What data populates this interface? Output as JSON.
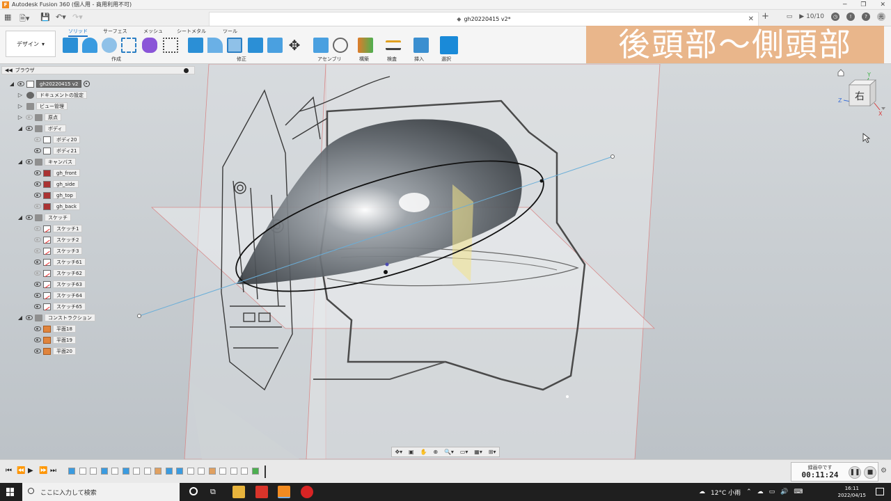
{
  "window": {
    "app_title": "Autodesk Fusion 360 (個人用 - 商用利用不可)",
    "app_icon": "fusion-logo-icon",
    "controls": [
      "minimize-icon",
      "restore-icon",
      "close-icon"
    ]
  },
  "document": {
    "tab_title": "gh20220415 v2*",
    "job_status": "10/10"
  },
  "user": {
    "initials": "光"
  },
  "ribbon": {
    "workspace": "デザイン",
    "tabs": [
      "ソリッド",
      "サーフェス",
      "メッシュ",
      "シートメタル",
      "ツール"
    ],
    "active_tab": "ソリッド",
    "groups": [
      "作成",
      "修正",
      "アセンブリ",
      "構築",
      "検査",
      "挿入",
      "選択"
    ]
  },
  "overlay": {
    "heading": "後頭部～側頭部"
  },
  "browser": {
    "title": "ブラウザ",
    "root": "gh20220415 v2",
    "nodes": {
      "doc_settings": "ドキュメントの設定",
      "named_views": "ビュー管理",
      "origin": "原点",
      "bodies": "ボディ",
      "body20": "ボディ20",
      "body21": "ボディ21",
      "canvases": "キャンバス",
      "gh_front": "gh_front",
      "gh_side": "gh_side",
      "gh_top": "gh_top",
      "gh_back": "gh_back",
      "sketches": "スケッチ",
      "sketch1": "スケッチ1",
      "sketch2": "スケッチ2",
      "sketch3": "スケッチ3",
      "sketch61": "スケッチ61",
      "sketch62": "スケッチ62",
      "sketch63": "スケッチ63",
      "sketch64": "スケッチ64",
      "sketch65": "スケッチ65",
      "construction": "コンストラクション",
      "plane18": "平面18",
      "plane19": "平面19",
      "plane20": "平面20"
    }
  },
  "viewcube": {
    "face": "右",
    "axes": {
      "y": "Y",
      "z": "Z",
      "x": "X"
    }
  },
  "recording": {
    "label": "録画中です",
    "time": "00:11:24"
  },
  "taskbar": {
    "search_placeholder": "ここに入力して検索",
    "weather": "12°C 小雨",
    "time": "16:11",
    "date": "2022/04/15"
  },
  "colors": {
    "accent": "#1a73c8",
    "overlay_bg": "#e6aa78",
    "fusion_orange": "#f28b20"
  }
}
